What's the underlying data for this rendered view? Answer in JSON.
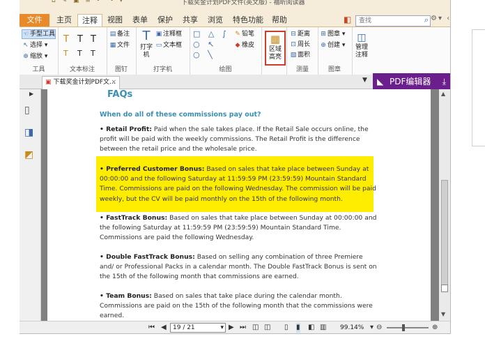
{
  "titlebar": {
    "quick_access": "⌂ ✎ ▣ ≡ ↶ ↷ ▾",
    "window_title": "下载奖金计划PDF文件(英文版) - 福昕阅读器"
  },
  "menu_tabs": [
    "文件",
    "主页",
    "注释",
    "视图",
    "表单",
    "保护",
    "共享",
    "浏览",
    "特色功能",
    "帮助"
  ],
  "search": {
    "placeholder": "查找"
  },
  "ribbon": {
    "tools": {
      "hand": "手型工具",
      "select": "选择",
      "zoom": "缩放",
      "label": "工具"
    },
    "text_markup": {
      "label": "文本标注"
    },
    "pin": {
      "note": "备注",
      "file": "文件",
      "label": "图钉"
    },
    "typewriter": {
      "big": "打字机",
      "comment_box": "注释框",
      "text_box": "文本框",
      "label": "打字机"
    },
    "drawing": {
      "pencil": "铅笔",
      "eraser": "橡皮",
      "label": "绘图"
    },
    "area_highlight": {
      "label": "区域高亮"
    },
    "measure": {
      "distance": "距离",
      "perimeter": "周长",
      "area": "面积",
      "label": "测量"
    },
    "stamp": {
      "stamp": "图章",
      "create": "创建",
      "label": "图章"
    },
    "manage": {
      "label": "管理注释"
    }
  },
  "doc_tab": {
    "title": "下载奖金计划PDF文..."
  },
  "promo": {
    "label": "PDF编辑器"
  },
  "document": {
    "heading": "FAQs",
    "question": "When do all of these commissions pay out?",
    "items": [
      {
        "bold": "• Retail Profit:",
        "text": " Paid when the sale takes place. If the Retail Sale occurs online, the profit will be paid with the weekly commissions. The Retail Profit is the difference between the retail price and the wholesale price."
      },
      {
        "bold": "• Preferred Customer Bonus:",
        "text": " Based on sales that take place between Sunday at 00:00:00 and the following Saturday at 11:59:59 PM (23:59:59) Mountain Standard Time. Commissions are paid on the following Wednesday. The commission will be paid weekly, but the CV will be paid monthly on the 15th of the following month."
      },
      {
        "bold": "• FastTrack Bonus:",
        "text": " Based on sales that take place between Sunday at 00:00:00 and the following Saturday at 11:59:59 PM (23:59:59) Mountain Standard Time. Commissions are paid the following Wednesday."
      },
      {
        "bold": "• Double FastTrack Bonus:",
        "text": " Based on selling any combination of three Premiere and/ or Professional Packs in a calendar month. The Double FastTrack Bonus is sent on the 15th of the following month that commissions are earned."
      },
      {
        "bold": "• Team Bonus:",
        "text": " Based on sales that take place during the calendar month. Commissions are paid on the 15th of the following month that the commissions were earned."
      }
    ],
    "highlight_color": "#ffed00",
    "heading_color": "#3a8fb5"
  },
  "status": {
    "page": "19 / 21",
    "zoom": "99.14%"
  }
}
